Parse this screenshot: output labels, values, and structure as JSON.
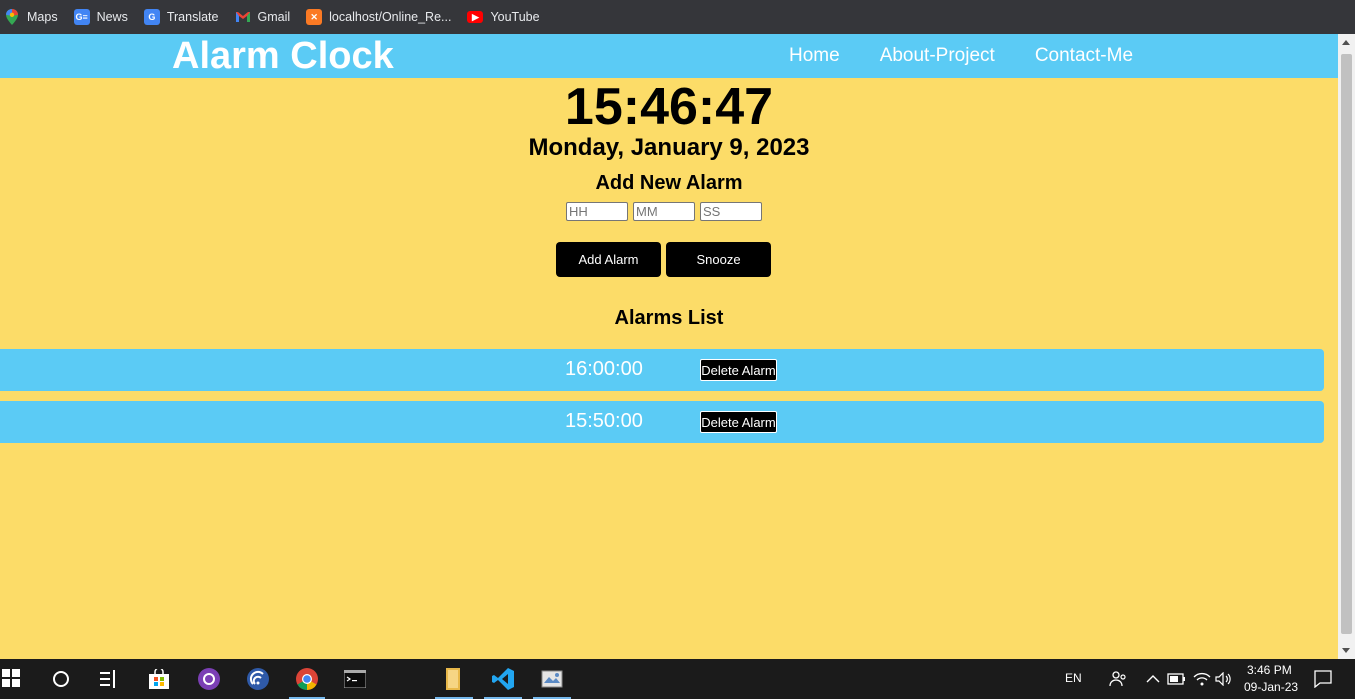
{
  "bookmarks": [
    {
      "label": "Maps",
      "icon": "maps-pin-icon",
      "color": "#34a853"
    },
    {
      "label": "News",
      "icon": "news-icon",
      "color": "#4285f4"
    },
    {
      "label": "Translate",
      "icon": "translate-icon",
      "color": "#4285f4"
    },
    {
      "label": "Gmail",
      "icon": "gmail-icon",
      "color": "#ea4335"
    },
    {
      "label": "localhost/Online_Re...",
      "icon": "xampp-icon",
      "color": "#fb7a24"
    },
    {
      "label": "YouTube",
      "icon": "youtube-icon",
      "color": "#ff0000"
    }
  ],
  "header": {
    "brand": "Alarm Clock",
    "nav": [
      "Home",
      "About-Project",
      "Contact-Me"
    ]
  },
  "clock": {
    "time": "15:46:47",
    "date": "Monday, January 9, 2023"
  },
  "add_alarm": {
    "title": "Add New Alarm",
    "placeholders": {
      "hh": "HH",
      "mm": "MM",
      "ss": "SS"
    },
    "add_label": "Add Alarm",
    "snooze_label": "Snooze"
  },
  "alarms": {
    "title": "Alarms List",
    "items": [
      {
        "time": "16:00:00",
        "delete_label": "Delete Alarm"
      },
      {
        "time": "15:50:00",
        "delete_label": "Delete Alarm"
      }
    ]
  },
  "taskbar": {
    "language": "EN",
    "time": "3:46 PM",
    "date": "09-Jan-23"
  },
  "colors": {
    "page_bg": "#fcdc68",
    "accent": "#5bcbf5",
    "button": "#000000"
  }
}
